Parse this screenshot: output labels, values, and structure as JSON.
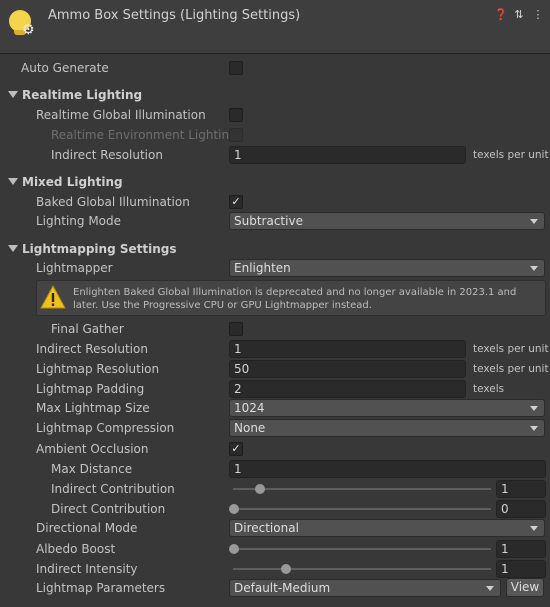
{
  "header": {
    "title": "Ammo Box Settings (Lighting Settings)",
    "icons": [
      "help-icon",
      "presets-icon",
      "kebab-menu-icon"
    ]
  },
  "auto_generate": {
    "label": "Auto Generate",
    "checked": false
  },
  "realtime": {
    "title": "Realtime Lighting",
    "rt_gi_label": "Realtime Global Illumination",
    "rt_env_label": "Realtime Environment Lighting",
    "indirect_res_label": "Indirect Resolution",
    "indirect_res_value": "1",
    "indirect_res_unit": "texels per unit"
  },
  "mixed": {
    "title": "Mixed Lighting",
    "baked_gi_label": "Baked Global Illumination",
    "baked_gi_checked": true,
    "mode_label": "Lighting Mode",
    "mode_value": "Subtractive"
  },
  "lightmapping": {
    "title": "Lightmapping Settings",
    "lightmapper_label": "Lightmapper",
    "lightmapper_value": "Enlighten",
    "warning": "Enlighten Baked Global Illumination is deprecated and no longer available in 2023.1 and later. Use the Progressive CPU or GPU Lightmapper instead.",
    "final_gather_label": "Final Gather",
    "indirect_res_label": "Indirect Resolution",
    "indirect_res_value": "1",
    "indirect_res_unit": "texels per unit",
    "lm_res_label": "Lightmap Resolution",
    "lm_res_value": "50",
    "lm_res_unit": "texels per unit",
    "lm_pad_label": "Lightmap Padding",
    "lm_pad_value": "2",
    "lm_pad_unit": "texels",
    "max_size_label": "Max Lightmap Size",
    "max_size_value": "1024",
    "compression_label": "Lightmap Compression",
    "compression_value": "None",
    "ao_label": "Ambient Occlusion",
    "ao_checked": true,
    "max_dist_label": "Max Distance",
    "max_dist_value": "1",
    "indirect_contrib_label": "Indirect Contribution",
    "indirect_contrib_value": "1",
    "indirect_contrib_fraction": 0.1,
    "direct_contrib_label": "Direct Contribution",
    "direct_contrib_value": "0",
    "direct_contrib_fraction": 0.0,
    "dir_mode_label": "Directional Mode",
    "dir_mode_value": "Directional",
    "albedo_label": "Albedo Boost",
    "albedo_value": "1",
    "albedo_fraction": 0.0,
    "indirect_int_label": "Indirect Intensity",
    "indirect_int_value": "1",
    "indirect_int_fraction": 0.2,
    "params_label": "Lightmap Parameters",
    "params_value": "Default-Medium",
    "view_label": "View"
  }
}
